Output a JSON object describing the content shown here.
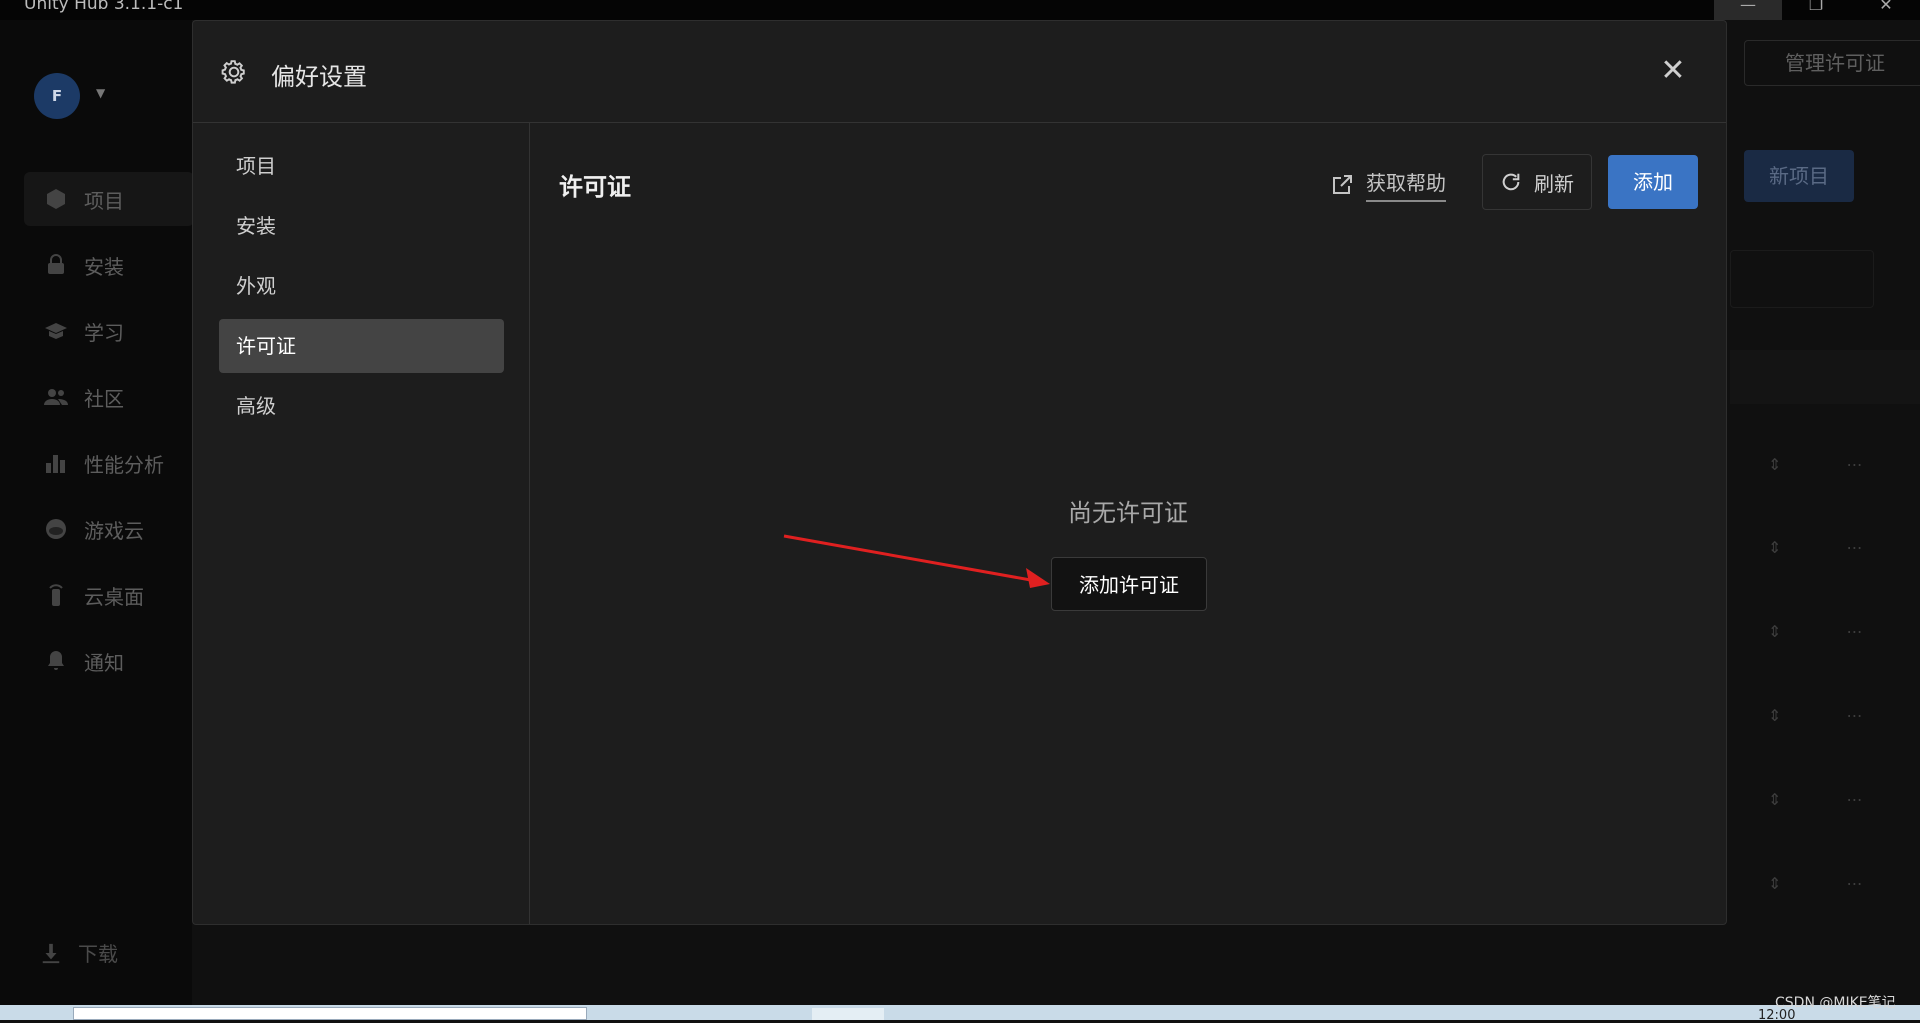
{
  "window": {
    "title": "Unity Hub 3.1.1-c1",
    "minimize_icon": "minimize-icon",
    "maximize_icon": "restore-icon",
    "close_icon": "close-icon"
  },
  "background": {
    "avatar_initial": "F",
    "nav": [
      {
        "label": "项目",
        "icon": "cube-icon"
      },
      {
        "label": "安装",
        "icon": "lock-icon"
      },
      {
        "label": "学习",
        "icon": "graduation-cap-icon"
      },
      {
        "label": "社区",
        "icon": "people-icon"
      },
      {
        "label": "性能分析",
        "icon": "bar-chart-icon"
      },
      {
        "label": "游戏云",
        "icon": "cloud-icon"
      },
      {
        "label": "云桌面",
        "icon": "remote-icon"
      },
      {
        "label": "通知",
        "icon": "bell-icon"
      }
    ],
    "download_label": "下载",
    "manage_license_label": "管理许可证",
    "new_project_label": "新项目"
  },
  "modal": {
    "title": "偏好设置",
    "close_label": "✕",
    "sidebar": [
      {
        "label": "项目",
        "active": false
      },
      {
        "label": "安装",
        "active": false
      },
      {
        "label": "外观",
        "active": false
      },
      {
        "label": "许可证",
        "active": true
      },
      {
        "label": "高级",
        "active": false
      }
    ],
    "content": {
      "title": "许可证",
      "help_label": "获取帮助",
      "refresh_label": "刷新",
      "add_label": "添加",
      "empty_text": "尚无许可证",
      "add_license_label": "添加许可证"
    }
  },
  "taskbar": {
    "clock": "12:00",
    "watermark": "CSDN @MIKE笔记"
  },
  "colors": {
    "accent": "#3a74c4",
    "arrow": "#e02020",
    "modal_bg": "#1d1d1d",
    "active_item": "#444444"
  }
}
